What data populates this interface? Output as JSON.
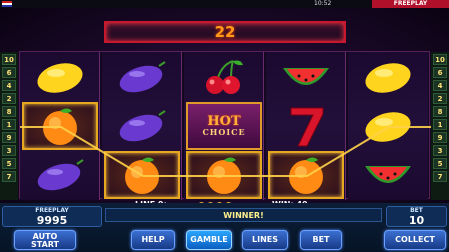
{
  "status_bar": {
    "time": "10:52",
    "mode": "FREEPLAY"
  },
  "win_display": {
    "value": "22"
  },
  "line_numbers_left": [
    "10",
    "6",
    "4",
    "2",
    "8",
    "1",
    "9",
    "3",
    "5",
    "7"
  ],
  "line_numbers_right": [
    "10",
    "6",
    "4",
    "2",
    "8",
    "1",
    "9",
    "3",
    "5",
    "7"
  ],
  "reels": [
    [
      "lemon-icon",
      "orange-icon",
      "plum-icon"
    ],
    [
      "plum-icon",
      "plum-icon",
      "orange-icon"
    ],
    [
      "cherry-icon",
      "hot-choice-symbol",
      "orange-icon"
    ],
    [
      "watermelon-icon",
      "seven-icon",
      "orange-icon"
    ],
    [
      "lemon-icon",
      "lemon-icon",
      "watermelon-icon"
    ]
  ],
  "hot_choice": {
    "line1": "HOT",
    "line2": "CHOICE"
  },
  "info": {
    "line": "LINE 9:",
    "win": "WIN: 40",
    "coins": 4
  },
  "freeplay": {
    "label": "FREEPLAY",
    "value": "9995"
  },
  "message": "WINNER!",
  "bet": {
    "label": "BET",
    "value": "10"
  },
  "buttons": {
    "auto_start_1": "AUTO",
    "auto_start_2": "START",
    "help": "HELP",
    "gamble": "GAMBLE",
    "lines": "LINES",
    "bet": "BET",
    "collect": "COLLECT"
  },
  "colors": {
    "win_frame": "#e6a820",
    "accent_red": "#c8182e",
    "button_blue": "#2f63c6"
  }
}
